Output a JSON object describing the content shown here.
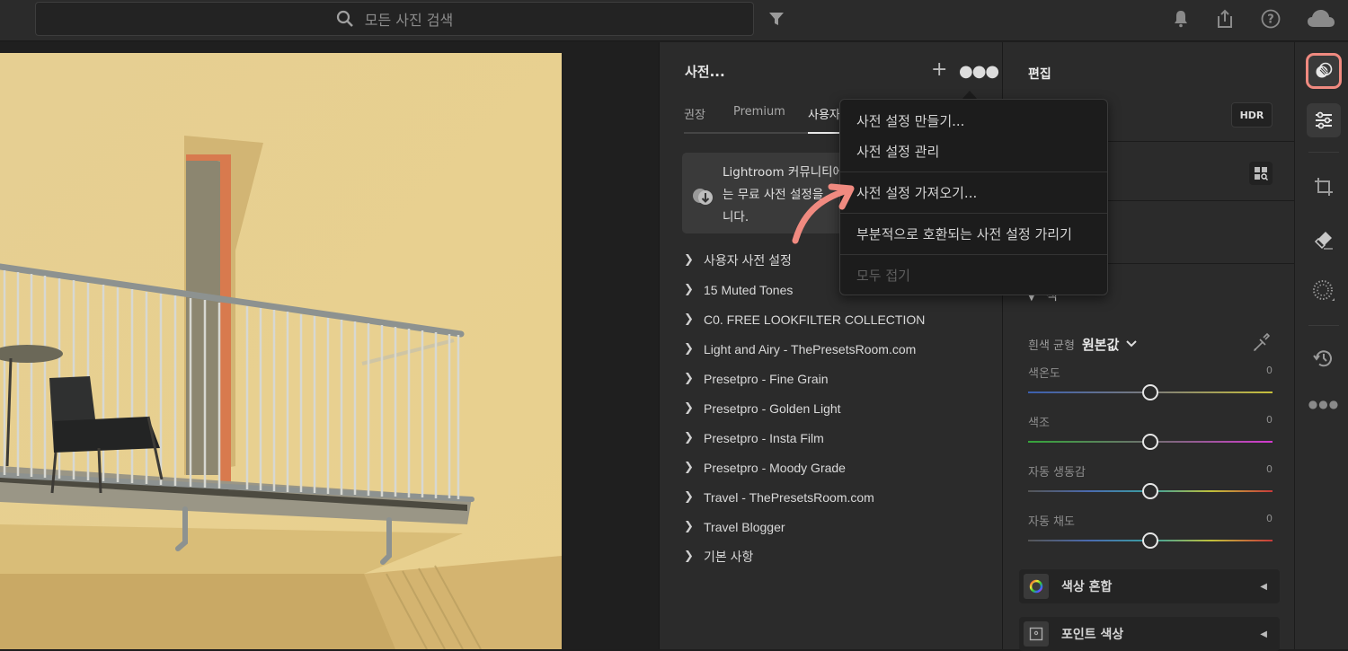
{
  "topbar": {
    "search_placeholder": "모든 사진 검색",
    "icons": [
      "search-icon",
      "filter-icon",
      "bell-icon",
      "share-icon",
      "help-icon",
      "cloud-icon"
    ]
  },
  "presets_panel": {
    "title": "사전...",
    "tabs": [
      {
        "label": "권장",
        "active": false
      },
      {
        "label": "Premium",
        "active": false
      },
      {
        "label": "사용자",
        "active": true
      }
    ],
    "notice": {
      "line1": "Lightroom 커뮤니티에",
      "line2": "는 무료 사전 설정을",
      "line3": "니다."
    },
    "groups": [
      "사용자 사전 설정",
      "15 Muted Tones",
      "C0. FREE LOOKFILTER COLLECTION",
      "Light and Airy - ThePresetsRoom.com",
      "Presetpro - Fine Grain",
      "Presetpro - Golden Light",
      "Presetpro - Insta Film",
      "Presetpro - Moody Grade",
      "Travel - ThePresetsRoom.com",
      "Travel Blogger",
      "기본 사항"
    ]
  },
  "context_menu": {
    "items": [
      {
        "label": "사전 설정 만들기...",
        "enabled": true
      },
      {
        "label": "사전 설정 관리",
        "enabled": true
      },
      {
        "label": "사전 설정 가져오기...",
        "enabled": true
      },
      {
        "label": "부분적으로 호환되는 사전 설정 가리기",
        "enabled": true
      },
      {
        "label": "모두 접기",
        "enabled": false
      }
    ]
  },
  "edit_panel": {
    "title": "편집",
    "hdr_label": "HDR",
    "color_section_label": "색",
    "white_balance": {
      "label": "흰색 균형",
      "value": "원본값"
    },
    "sliders": [
      {
        "name": "색온도",
        "value": "0",
        "position": 0.5,
        "gradient": [
          "#3a5fb0",
          "#7b7b7b",
          "#c8c03a"
        ]
      },
      {
        "name": "색조",
        "value": "0",
        "position": 0.5,
        "gradient": [
          "#35a53a",
          "#6f6f6f",
          "#d43ad0"
        ]
      },
      {
        "name": "자동 생동감",
        "value": "0",
        "position": 0.5,
        "gradient": [
          "#555555",
          "#4a6ab0",
          "#3aa0a0",
          "#c0c03a",
          "#c83a3a"
        ]
      },
      {
        "name": "자동 채도",
        "value": "0",
        "position": 0.5,
        "gradient": [
          "#555555",
          "#4a6ab0",
          "#3aa0a0",
          "#c0c03a",
          "#c83a3a"
        ]
      }
    ],
    "sections": [
      {
        "label": "색상 혼합",
        "icon": "color-wheel-icon"
      },
      {
        "label": "포인트 색상",
        "icon": "point-color-icon"
      }
    ]
  },
  "tool_rail": {
    "items": [
      "presets-icon",
      "edit-sliders-icon",
      "crop-icon",
      "heal-eraser-icon",
      "masking-icon",
      "history-icon",
      "more-icon"
    ],
    "highlighted": "presets-icon"
  },
  "colors": {
    "accent_highlight": "#f08a80",
    "panel_bg": "#2b2b2b",
    "menu_bg": "#1c1c1c"
  }
}
